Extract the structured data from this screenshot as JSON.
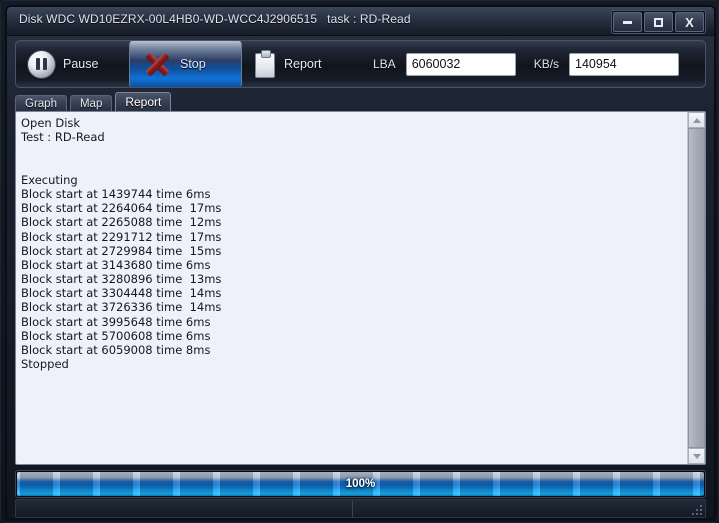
{
  "window": {
    "title_disk": "Disk WDC WD10EZRX-00L4HB0-WD-WCC4J2906515",
    "title_task": "task : RD-Read",
    "controls": {
      "minimize": "–",
      "maximize": "□",
      "close": "X"
    }
  },
  "toolbar": {
    "pause_label": "Pause",
    "stop_label": "Stop",
    "report_label": "Report",
    "lba_label": "LBA",
    "lba_value": "6060032",
    "kbs_label": "KB/s",
    "kbs_value": "140954",
    "active_button": "Stop",
    "active_color": "#1272d6"
  },
  "tabs": [
    {
      "label": "Graph",
      "active": false
    },
    {
      "label": "Map",
      "active": false
    },
    {
      "label": "Report",
      "active": true
    }
  ],
  "report": {
    "lines": [
      "Open Disk",
      "Test : RD-Read",
      "",
      "",
      "Executing",
      "Block start at 1439744 time 6ms",
      "Block start at 2264064 time  17ms",
      "Block start at 2265088 time  12ms",
      "Block start at 2291712 time  17ms",
      "Block start at 2729984 time  15ms",
      "Block start at 3143680 time 6ms",
      "Block start at 3280896 time  13ms",
      "Block start at 3304448 time  14ms",
      "Block start at 3726336 time  14ms",
      "Block start at 3995648 time 6ms",
      "Block start at 5700608 time 6ms",
      "Block start at 6059008 time 8ms",
      "Stopped"
    ]
  },
  "progress": {
    "percent_label": "100%",
    "percent": 100,
    "color": "#16a8f5"
  },
  "statusbar": {
    "left_text": "",
    "right_text": ""
  }
}
